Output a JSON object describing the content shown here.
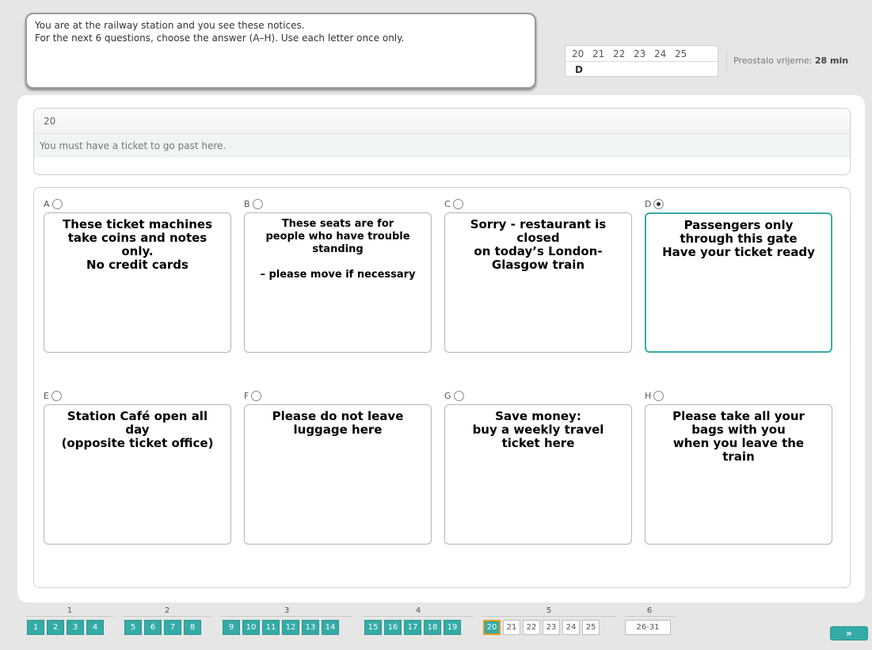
{
  "instructions": {
    "line1": "You are at the railway station and you see these notices.",
    "line2": "For the next 6 questions, choose the answer (A–H). Use each letter once only."
  },
  "question_table": {
    "numbers": [
      "20",
      "21",
      "22",
      "23",
      "24",
      "25"
    ],
    "answers": [
      "D",
      "",
      "",
      "",
      "",
      ""
    ]
  },
  "timer": {
    "label": "Preostalo vrijeme:",
    "value": "28 min"
  },
  "question": {
    "number": "20",
    "text": "You must have a ticket to go past here."
  },
  "options": [
    {
      "letter": "A",
      "text": "These ticket machines\ntake coins and notes\nonly.\nNo credit cards",
      "selected": false
    },
    {
      "letter": "B",
      "text": "These seats are for\npeople who have trouble\nstanding\n\n– please move if necessary",
      "selected": false
    },
    {
      "letter": "C",
      "text": "Sorry - restaurant is\nclosed\non today’s London-\nGlasgow train",
      "selected": false
    },
    {
      "letter": "D",
      "text": "Passengers only\nthrough this gate\nHave your ticket ready",
      "selected": true
    },
    {
      "letter": "E",
      "text": "Station Café open all\nday\n(opposite ticket office)",
      "selected": false
    },
    {
      "letter": "F",
      "text": "Please do not leave\nluggage here",
      "selected": false
    },
    {
      "letter": "G",
      "text": "Save money:\nbuy a weekly travel\nticket here",
      "selected": false
    },
    {
      "letter": "H",
      "text": "Please take all your\nbags with you\nwhen you leave the\ntrain",
      "selected": false
    }
  ],
  "nav": {
    "groups": [
      {
        "label": "1",
        "items": [
          "1",
          "2",
          "3",
          "4"
        ]
      },
      {
        "label": "2",
        "items": [
          "5",
          "6",
          "7",
          "8"
        ]
      },
      {
        "label": "3",
        "items": [
          "9",
          "10",
          "11",
          "12",
          "13",
          "14"
        ]
      },
      {
        "label": "4",
        "items": [
          "15",
          "16",
          "17",
          "18",
          "19"
        ]
      },
      {
        "label": "5",
        "items": [
          "20",
          "21",
          "22",
          "23",
          "24",
          "25"
        ]
      },
      {
        "label": "6",
        "items": [
          "26-31"
        ]
      }
    ],
    "current": "20",
    "next_label": "»",
    "accent_color": "#35aba6",
    "current_border_color": "#e39a1c"
  }
}
